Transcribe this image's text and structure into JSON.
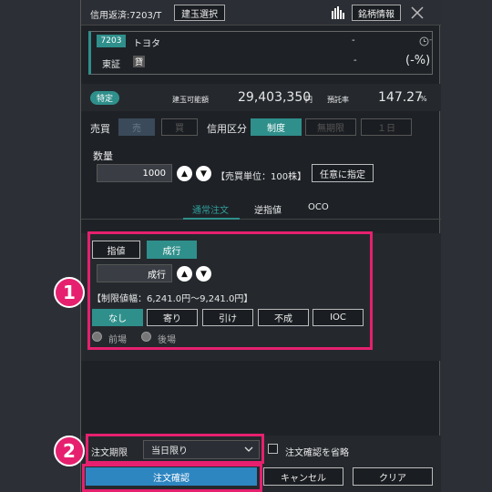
{
  "title": {
    "label": "信用返済:7203/T",
    "position_select": "建玉選択",
    "stock_info": "銘柄情報"
  },
  "stock": {
    "code": "7203",
    "name": "トヨタ",
    "price": "-",
    "time": "-",
    "market": "東証",
    "badge": "貸",
    "change": "-",
    "change_pct": "(-%)"
  },
  "position": {
    "tag": "特定",
    "value_label": "建玉可能額",
    "value": "29,403,350",
    "value_unit": "円",
    "margin_label": "預託率",
    "margin_value": "147.27",
    "margin_unit": "%"
  },
  "trade": {
    "label": "売買",
    "sell": "売",
    "buy": "買",
    "credit_label": "信用区分",
    "institutional": "制度",
    "indefinite": "無期限",
    "one_day": "１日"
  },
  "quantity": {
    "label": "数量",
    "value": "1000",
    "unit_note": "【売買単位：100株】",
    "any_button": "任意に指定"
  },
  "tabs": [
    "通常注文",
    "逆指値",
    "OCO"
  ],
  "order": {
    "limit": "指値",
    "market": "成行",
    "price_field": "成行",
    "range": "【制限値幅：6,241.0円〜9,241.0円】",
    "conditions": [
      "なし",
      "寄り",
      "引け",
      "不成",
      "IOC"
    ],
    "session_am": "前場",
    "session_pm": "後場"
  },
  "annotations": {
    "one": "1",
    "two": "2"
  },
  "footer": {
    "period_label": "注文期限",
    "period_value": "当日限り",
    "skip_confirm": "注文確認を省略",
    "confirm": "注文確認",
    "cancel": "キャンセル",
    "clear": "クリア"
  },
  "icons": {
    "bar_chart": "bar-chart-icon",
    "close": "close-icon",
    "clock": "clock-icon",
    "up": "triangle-up-icon",
    "down": "triangle-down-icon",
    "chevron": "chevron-down-icon"
  },
  "colors": {
    "accent_teal": "#2f8f8b",
    "highlight_pink": "#e6206e",
    "confirm_blue": "#2e86c1"
  }
}
